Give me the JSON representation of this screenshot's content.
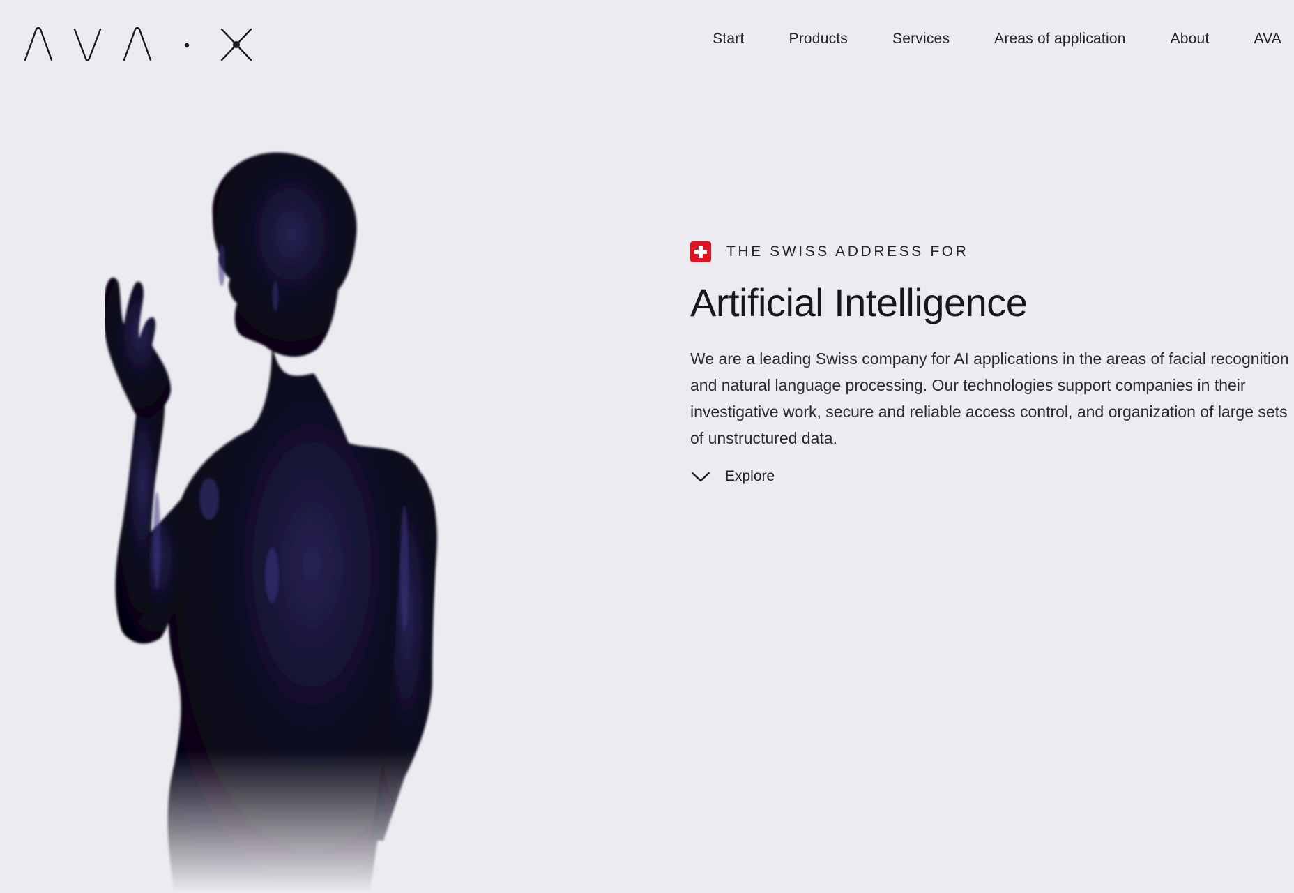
{
  "header": {
    "logo_text": "AVA·X",
    "nav": [
      {
        "label": "Start"
      },
      {
        "label": "Products"
      },
      {
        "label": "Services"
      },
      {
        "label": "Areas of application"
      },
      {
        "label": "About"
      },
      {
        "label": "AVA"
      }
    ]
  },
  "hero": {
    "flag_icon": "swiss-flag-icon",
    "eyebrow": "THE SWISS ADDRESS FOR",
    "headline": "Artificial Intelligence",
    "description": "We are a leading Swiss company for AI applications in the areas of facial recognition and natural language processing. Our technologies support companies in their investigative work, secure and reliable access control, and organization of large sets of unstructured data.",
    "explore": {
      "icon": "chevron-down-icon",
      "label": "Explore"
    },
    "image": "dark-humanoid-figure"
  },
  "colors": {
    "background": "#ecebf0",
    "text": "#1a1a24",
    "flag_red": "#e3101f",
    "figure": "#0b0a1a",
    "figure_highlight": "#2a2660"
  }
}
